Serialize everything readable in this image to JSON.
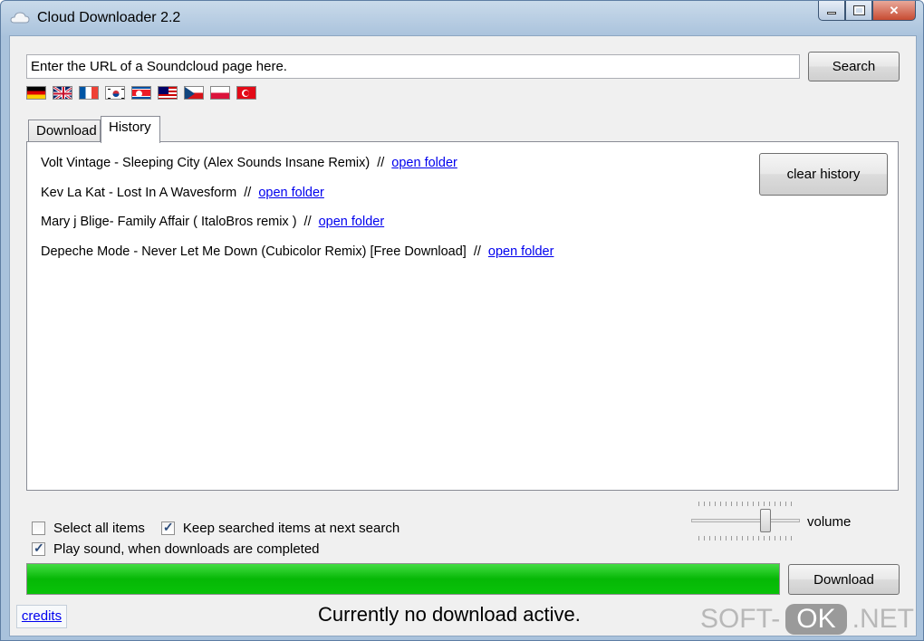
{
  "window": {
    "title": "Cloud Downloader 2.2"
  },
  "search": {
    "placeholder": "Enter the URL of a Soundcloud page here.",
    "value": "Enter the URL of a Soundcloud page here.",
    "button_label": "Search"
  },
  "flags": [
    {
      "name": "german-flag-icon"
    },
    {
      "name": "english-flag-icon"
    },
    {
      "name": "french-flag-icon"
    },
    {
      "name": "korean-flag-icon"
    },
    {
      "name": "north-korean-flag-icon"
    },
    {
      "name": "malaysian-flag-icon"
    },
    {
      "name": "czech-flag-icon"
    },
    {
      "name": "polish-flag-icon"
    },
    {
      "name": "turkish-flag-icon"
    }
  ],
  "tabs": [
    {
      "label": "Download"
    },
    {
      "label": "History"
    }
  ],
  "history": {
    "items": [
      {
        "title": "Volt  Vintage - Sleeping City (Alex Sounds Insane Remix)",
        "sep": "//",
        "link": "open folder"
      },
      {
        "title": "Kev La Kat - Lost In A Wavesform",
        "sep": "//",
        "link": "open folder"
      },
      {
        "title": "Mary j Blige- Family Affair ( ItaloBros remix )",
        "sep": "//",
        "link": "open folder"
      },
      {
        "title": "Depeche Mode - Never Let Me Down (Cubicolor Remix) [Free Download]",
        "sep": "//",
        "link": "open folder"
      }
    ],
    "clear_label": "clear history"
  },
  "options": {
    "select_all": {
      "label": "Select all items",
      "checked": false
    },
    "keep_searched": {
      "label": "Keep searched items at next search",
      "checked": true
    },
    "play_sound": {
      "label": "Play sound, when downloads are completed",
      "checked": true
    }
  },
  "volume": {
    "label": "volume",
    "level": 0.7
  },
  "progress": {
    "value": 1.0,
    "color": "#09c209"
  },
  "download_button": {
    "label": "Download"
  },
  "credits": {
    "label": "credits"
  },
  "status": {
    "text": "Currently no download active."
  },
  "watermark": {
    "left": "SOFT-",
    "mid": "OK",
    "right": ".NET"
  },
  "colors": {
    "link": "#0000ee",
    "progress": "#09c209"
  }
}
